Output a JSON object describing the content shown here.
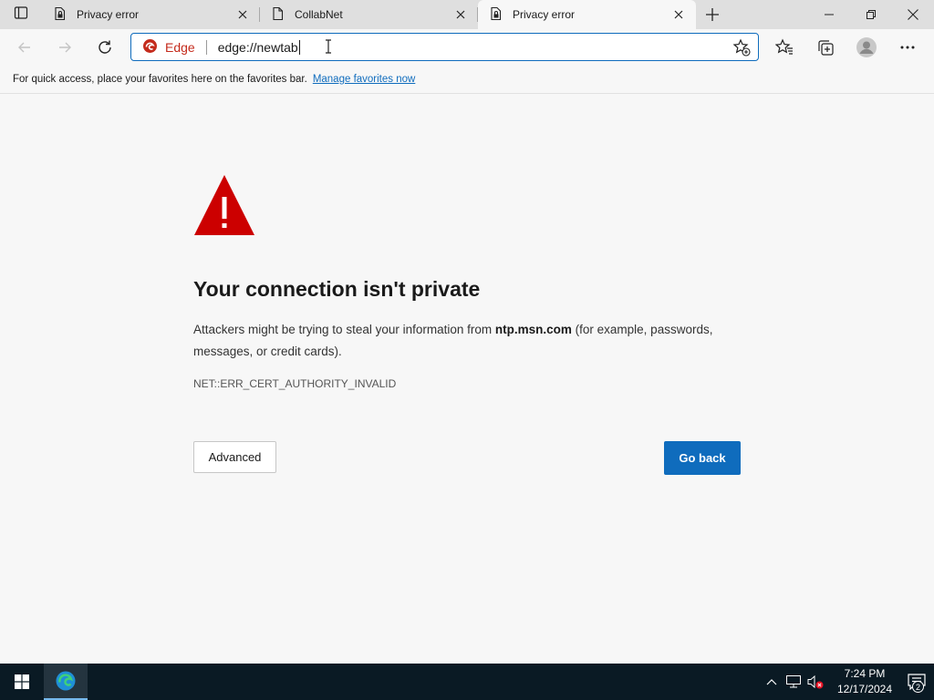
{
  "browser": {
    "tabs": [
      {
        "title": "Privacy error",
        "icon": "lock-warning-page-icon",
        "active": false
      },
      {
        "title": "CollabNet",
        "icon": "page-icon",
        "active": false
      },
      {
        "title": "Privacy error",
        "icon": "lock-warning-page-icon",
        "active": true
      }
    ],
    "address_bar": {
      "site_label": "Edge",
      "url": "edge://newtab"
    },
    "favorites_bar": {
      "message": "For quick access, place your favorites here on the favorites bar.",
      "link": "Manage favorites now"
    }
  },
  "page": {
    "heading": "Your connection isn't private",
    "description_before": "Attackers might be trying to steal your information from ",
    "host": "ntp.msn.com",
    "description_after": " (for example, passwords, messages, or credit cards).",
    "error_code": "NET::ERR_CERT_AUTHORITY_INVALID",
    "advanced_label": "Advanced",
    "go_back_label": "Go back"
  },
  "taskbar": {
    "time": "7:24 PM",
    "date": "12/17/2024",
    "notification_count": "2"
  },
  "colors": {
    "accent": "#0f6cbd",
    "warning": "#cc0000",
    "taskbar": "#0a1a24"
  }
}
